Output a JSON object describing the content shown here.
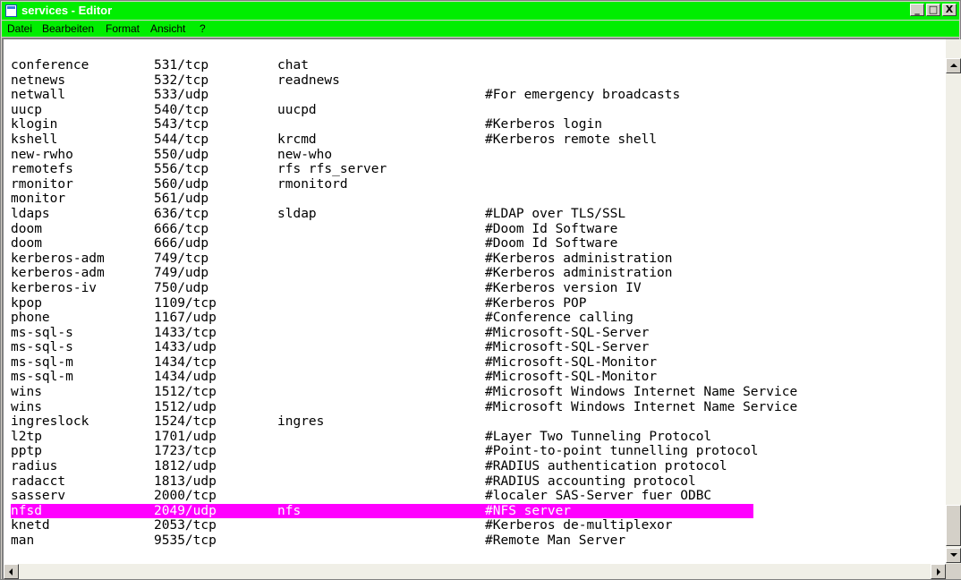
{
  "window": {
    "title": "services - Editor",
    "controls": {
      "minimize": "_",
      "maximize": "□",
      "close": "X"
    }
  },
  "menu": [
    {
      "label": "Datei"
    },
    {
      "label": "Bearbeiten"
    },
    {
      "label": "Format"
    },
    {
      "label": "Ansicht"
    },
    {
      "label": "?"
    }
  ],
  "colors": {
    "titlebar": "#00ee00",
    "highlight": "#ff00ff"
  },
  "highlighted_line": 31,
  "lines": [
    [
      "conference",
      "531/tcp",
      "chat",
      ""
    ],
    [
      "netnews",
      "532/tcp",
      "readnews",
      ""
    ],
    [
      "netwall",
      "533/udp",
      "",
      "#For emergency broadcasts"
    ],
    [
      "uucp",
      "540/tcp",
      "uucpd",
      ""
    ],
    [
      "klogin",
      "543/tcp",
      "",
      "#Kerberos login"
    ],
    [
      "kshell",
      "544/tcp",
      "krcmd",
      "#Kerberos remote shell"
    ],
    [
      "new-rwho",
      "550/udp",
      "new-who",
      ""
    ],
    [
      "remotefs",
      "556/tcp",
      "rfs rfs_server",
      ""
    ],
    [
      "rmonitor",
      "560/udp",
      "rmonitord",
      ""
    ],
    [
      "monitor",
      "561/udp",
      "",
      ""
    ],
    [
      "ldaps",
      "636/tcp",
      "sldap",
      "#LDAP over TLS/SSL"
    ],
    [
      "doom",
      "666/tcp",
      "",
      "#Doom Id Software"
    ],
    [
      "doom",
      "666/udp",
      "",
      "#Doom Id Software"
    ],
    [
      "kerberos-adm",
      "749/tcp",
      "",
      "#Kerberos administration"
    ],
    [
      "kerberos-adm",
      "749/udp",
      "",
      "#Kerberos administration"
    ],
    [
      "kerberos-iv",
      "750/udp",
      "",
      "#Kerberos version IV"
    ],
    [
      "kpop",
      "1109/tcp",
      "",
      "#Kerberos POP"
    ],
    [
      "phone",
      "1167/udp",
      "",
      "#Conference calling"
    ],
    [
      "ms-sql-s",
      "1433/tcp",
      "",
      "#Microsoft-SQL-Server"
    ],
    [
      "ms-sql-s",
      "1433/udp",
      "",
      "#Microsoft-SQL-Server"
    ],
    [
      "ms-sql-m",
      "1434/tcp",
      "",
      "#Microsoft-SQL-Monitor"
    ],
    [
      "ms-sql-m",
      "1434/udp",
      "",
      "#Microsoft-SQL-Monitor"
    ],
    [
      "wins",
      "1512/tcp",
      "",
      "#Microsoft Windows Internet Name Service"
    ],
    [
      "wins",
      "1512/udp",
      "",
      "#Microsoft Windows Internet Name Service"
    ],
    [
      "ingreslock",
      "1524/tcp",
      "ingres",
      ""
    ],
    [
      "l2tp",
      "1701/udp",
      "",
      "#Layer Two Tunneling Protocol"
    ],
    [
      "pptp",
      "1723/tcp",
      "",
      "#Point-to-point tunnelling protocol"
    ],
    [
      "radius",
      "1812/udp",
      "",
      "#RADIUS authentication protocol"
    ],
    [
      "radacct",
      "1813/udp",
      "",
      "#RADIUS accounting protocol"
    ],
    [
      "sasserv",
      "2000/tcp",
      "",
      "#localer SAS-Server fuer ODBC"
    ],
    [
      "nfsd",
      "2049/udp",
      "nfs",
      "#NFS server"
    ],
    [
      "knetd",
      "2053/tcp",
      "",
      "#Kerberos de-multiplexor"
    ],
    [
      "man",
      "9535/tcp",
      "",
      "#Remote Man Server"
    ]
  ]
}
